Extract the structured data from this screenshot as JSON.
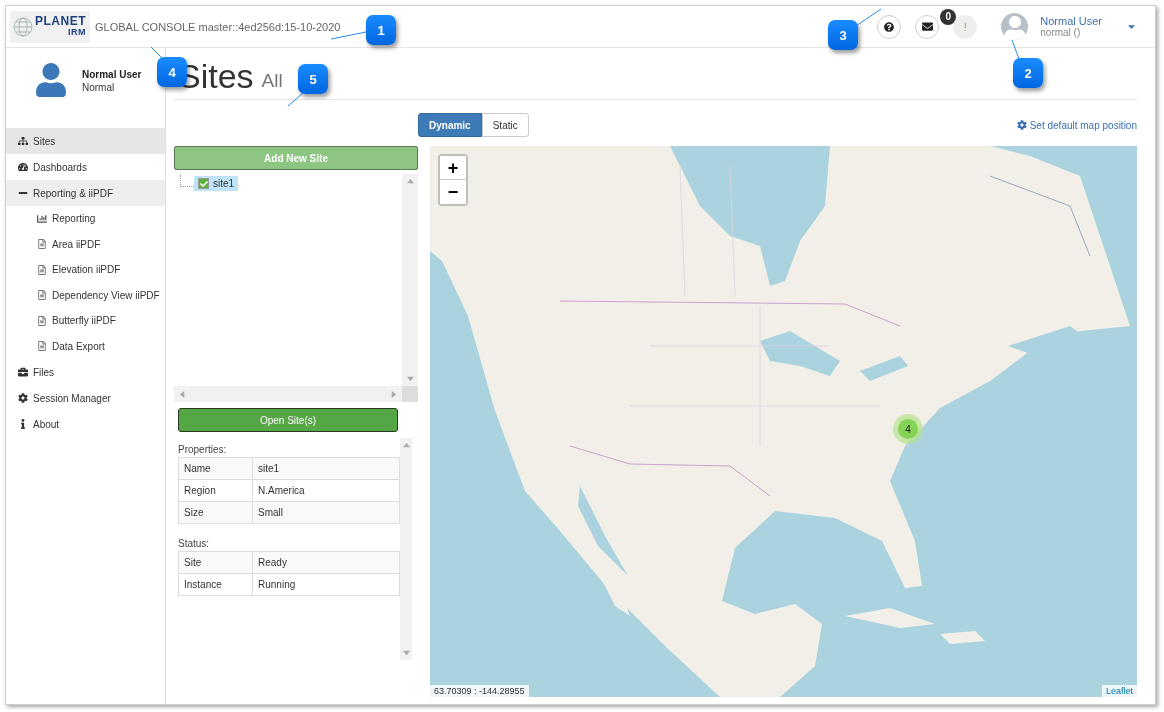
{
  "header": {
    "logo": {
      "line1": "PLANET",
      "line2": "IRM"
    },
    "console_title": "GLOBAL CONSOLE master::4ed256d:15-10-2020",
    "messages_count": "0",
    "alert": "!",
    "user": {
      "name": "Normal User",
      "subtitle": "normal ()"
    }
  },
  "sidebar": {
    "profile": {
      "name": "Normal User",
      "role": "Normal"
    },
    "items": [
      {
        "label": "Sites",
        "selected": true
      },
      {
        "label": "Dashboards",
        "selected": false
      },
      {
        "label": "Reporting & iiPDF",
        "expanded": true,
        "children": [
          {
            "label": "Reporting",
            "selected": false
          },
          {
            "label": "Area iiPDF",
            "selected": false
          },
          {
            "label": "Elevation iiPDF",
            "selected": false
          },
          {
            "label": "Dependency View iiPDF",
            "selected": false
          },
          {
            "label": "Butterfly iiPDF",
            "selected": false
          },
          {
            "label": "Data Export",
            "selected": false
          }
        ]
      },
      {
        "label": "Files",
        "selected": false
      },
      {
        "label": "Session Manager",
        "selected": false
      },
      {
        "label": "About",
        "selected": false
      }
    ]
  },
  "page": {
    "title": "Sites",
    "subtitle": "All"
  },
  "view_toggle": [
    {
      "label": "Dynamic",
      "selected": true
    },
    {
      "label": "Static",
      "selected": false
    }
  ],
  "map_position_link": "Set default map position",
  "left_panel": {
    "add_button": "Add New Site",
    "tree": [
      {
        "label": "site1",
        "checked": true,
        "selected": true
      }
    ],
    "open_button": "Open Site(s)",
    "properties": {
      "label": "Properties:",
      "rows": [
        [
          "Name",
          "site1"
        ],
        [
          "Region",
          "N.America"
        ],
        [
          "Size",
          "Small"
        ]
      ]
    },
    "status": {
      "label": "Status:",
      "rows": [
        [
          "Site",
          "Ready"
        ],
        [
          "Instance",
          "Running"
        ]
      ]
    }
  },
  "map": {
    "kind": "picture",
    "zoom_in": "+",
    "zoom_out": "−",
    "cluster_count": "4",
    "coordinates": "63.70309 : -144.28955",
    "attribution": "Leaflet"
  },
  "callouts": [
    {
      "number": "1"
    },
    {
      "number": "2"
    },
    {
      "number": "3"
    },
    {
      "number": "4"
    },
    {
      "number": "5"
    }
  ]
}
